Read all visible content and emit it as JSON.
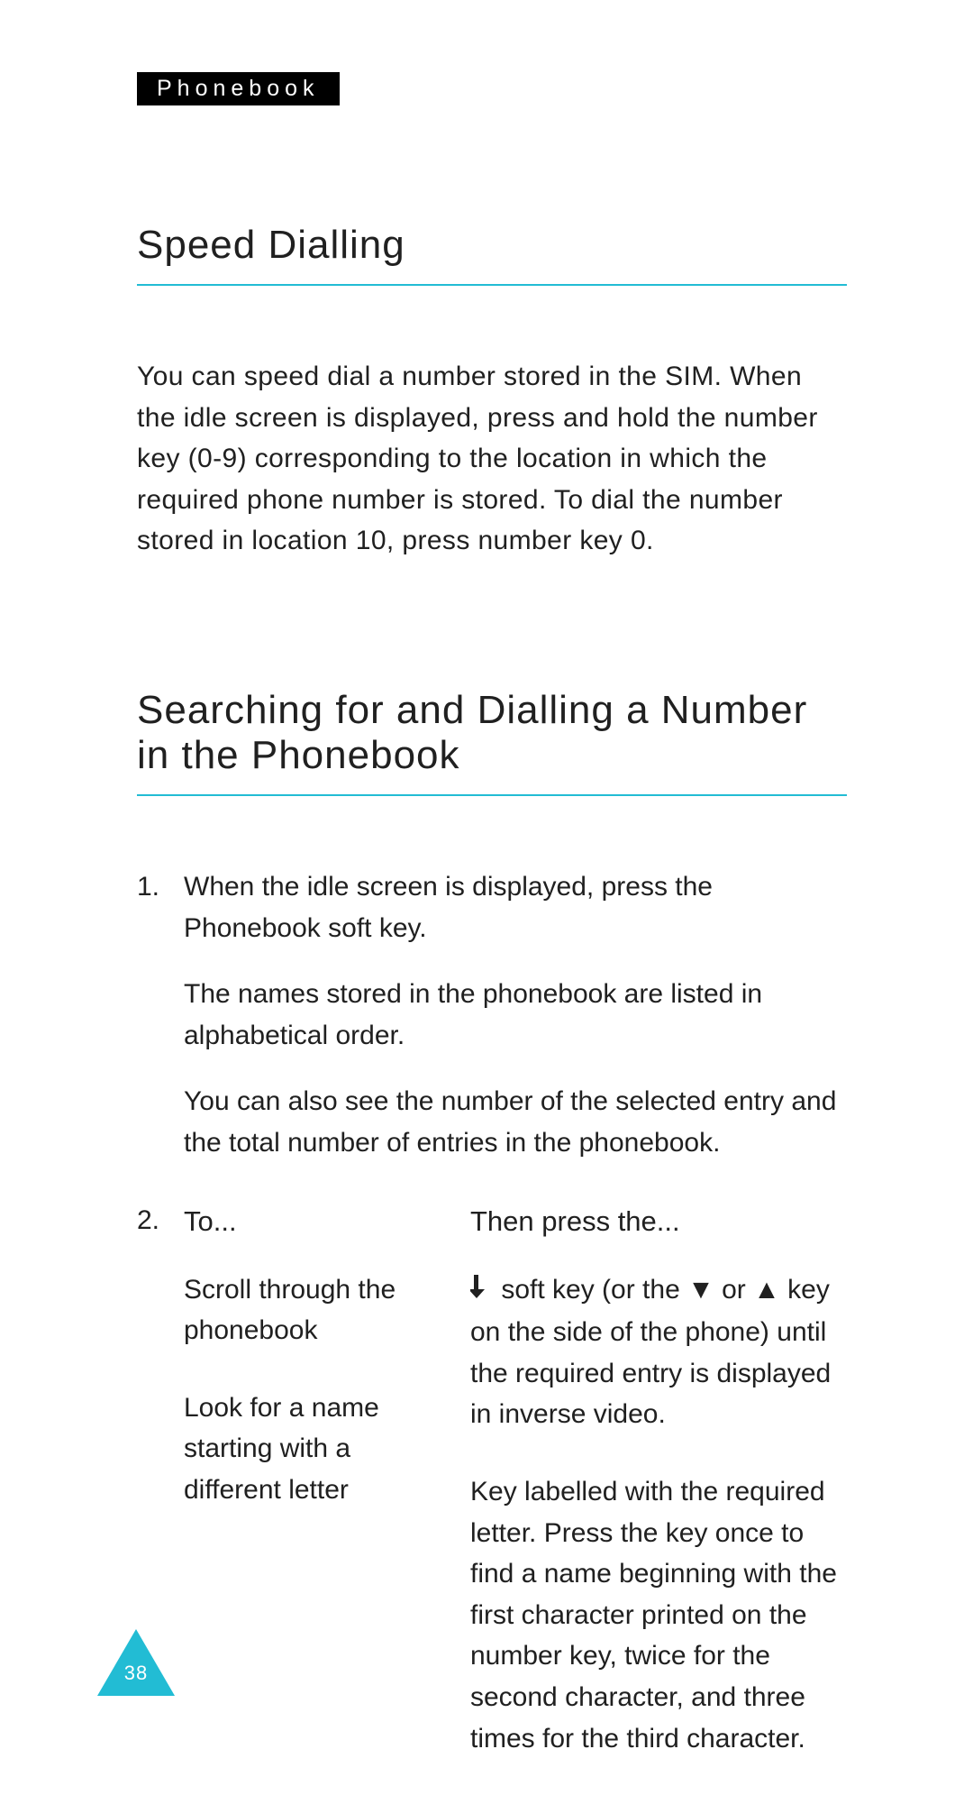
{
  "chapter_tag": "Phonebook",
  "section1": {
    "title": "Speed Dialling",
    "body": "You can speed dial a number stored in the SIM. When the idle screen is displayed, press and hold the number key (0-9) corresponding to the location in which the required phone number is stored. To dial the number stored in location 10, press number key 0."
  },
  "section2": {
    "title": "Searching for and Dialling a Number in the Phonebook",
    "step1": {
      "num": "1.",
      "line1": "When the idle screen is displayed, press the Phonebook soft key.",
      "line2": "The names stored in the phonebook are listed in alphabetical order.",
      "line3": "You can also see the number of the selected entry and the total number of entries in the phonebook."
    },
    "step2": {
      "num": "2.",
      "header_left": "To...",
      "header_right": "Then press the...",
      "rows": [
        {
          "left": "Scroll through the phonebook",
          "right_before_icon": "",
          "right_after_icon": "  soft key (or the  ▼  or  ▲ key on the side of the phone) until the required entry is displayed in inverse video."
        },
        {
          "left": "Look for a name starting with a different letter",
          "right": "Key labelled with the required letter. Press the key once to find a name beginning with the first character printed on the number key, twice for the second character, and three times for the third character."
        }
      ]
    }
  },
  "page_number": "38",
  "accent_color": "#22bcd4"
}
